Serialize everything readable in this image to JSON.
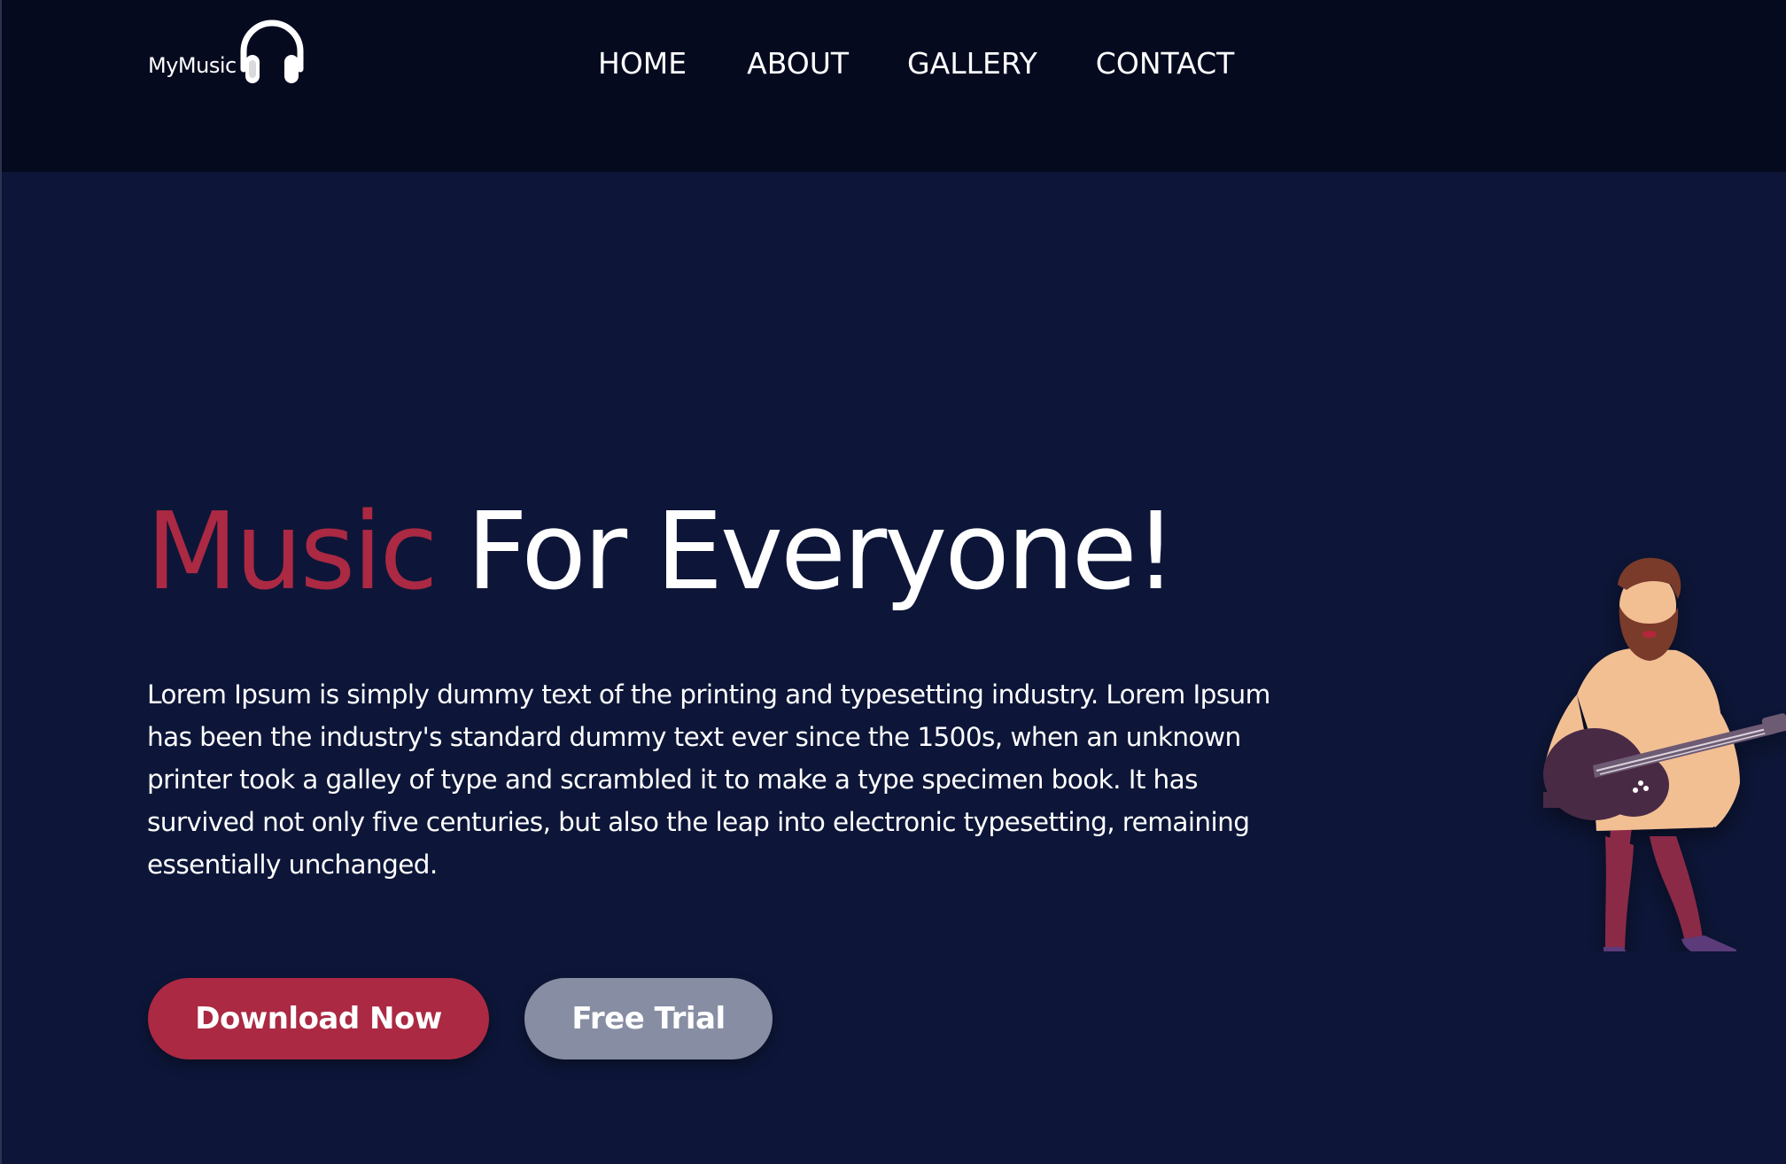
{
  "brand": {
    "name": "MyMusic",
    "icon": "headphones-icon"
  },
  "nav": {
    "items": [
      {
        "label": "HOME"
      },
      {
        "label": "ABOUT"
      },
      {
        "label": "GALLERY"
      },
      {
        "label": "CONTACT"
      }
    ]
  },
  "hero": {
    "title_accent": "Music",
    "title_rest": "For Everyone!",
    "description": "Lorem Ipsum is simply dummy text of the printing and typesetting industry. Lorem Ipsum has been the industry's standard dummy text ever since the 1500s, when an unknown printer took a galley of type and scrambled it to make a type specimen book. It has survived not only five centuries, but also the leap into electronic typesetting, remaining essentially unchanged.",
    "primary_button": "Download Now",
    "secondary_button": "Free Trial",
    "illustration": "guitarist-illustration"
  },
  "colors": {
    "background": "#0d1638",
    "navbar": "#050a1f",
    "accent": "#ab2943",
    "secondary_button": "#878da2",
    "text": "#ffffff"
  }
}
